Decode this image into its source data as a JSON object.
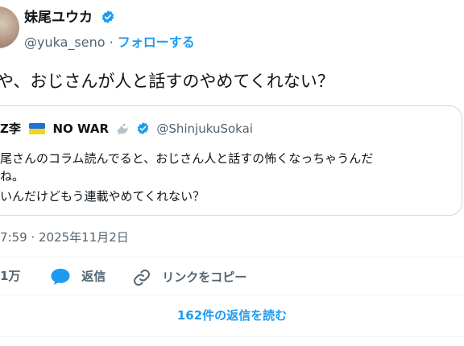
{
  "author": {
    "name": "妹尾ユウカ",
    "handle": "@yuka_seno",
    "separator": "·",
    "follow_label": "フォローする"
  },
  "tweet": {
    "text": "や、おじさんが人と話すのやめてくれない？"
  },
  "quoted": {
    "name": "Z李",
    "no_war": "NO WAR",
    "handle": "@ShinjukuSokai",
    "lines": [
      "尾さんのコラム読んでると、おじさん人と話すの怖くなっちゃうんだ",
      "ね。",
      "いんだけどもう連載やめてくれない？"
    ]
  },
  "meta": {
    "timestamp": "7:59 · 2025年11月2日"
  },
  "actions": {
    "likes_count": "1万",
    "reply_label": "返信",
    "copy_link_label": "リンクをコピー"
  },
  "read_replies_label": "162件の返信を読む",
  "colors": {
    "accent": "#1d9bf0",
    "like": "#f91880",
    "secondary_text": "#536471",
    "border": "#cfd9de"
  }
}
